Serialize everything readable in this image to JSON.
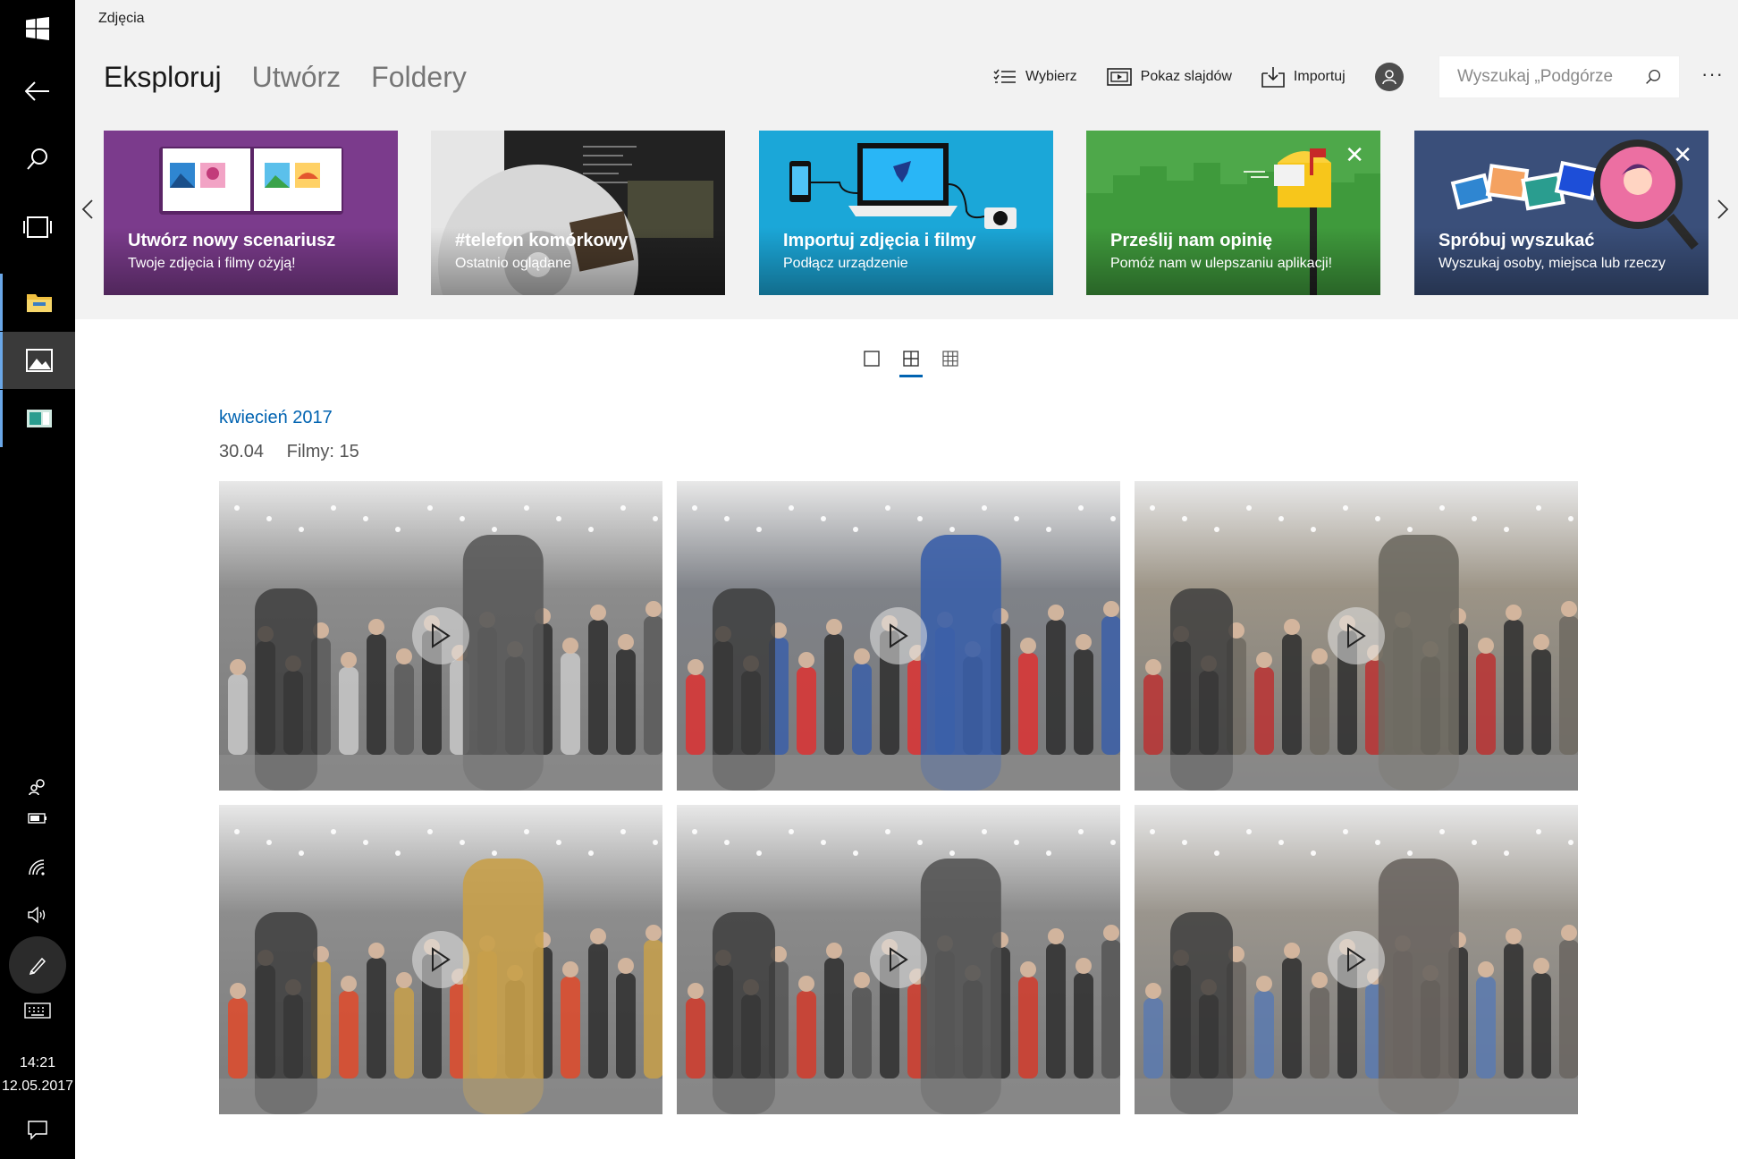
{
  "app": {
    "title": "Zdjęcia"
  },
  "tabs": [
    {
      "label": "Eksploruj",
      "active": true
    },
    {
      "label": "Utwórz",
      "active": false
    },
    {
      "label": "Foldery",
      "active": false
    }
  ],
  "toolbar": {
    "select_label": "Wybierz",
    "slideshow_label": "Pokaz slajdów",
    "import_label": "Importuj",
    "more_label": "···"
  },
  "search": {
    "placeholder": "Wyszukaj „Podgórze"
  },
  "cards": [
    {
      "title": "Utwórz nowy scenariusz",
      "subtitle": "Twoje zdjęcia i filmy ożyją!",
      "color": "#7b3b8c"
    },
    {
      "title": "#telefon komórkowy",
      "subtitle": "Ostatnio oglądane",
      "color": "#cfcfcf"
    },
    {
      "title": "Importuj zdjęcia i filmy",
      "subtitle": "Podłącz urządzenie",
      "color": "#1ba7d8"
    },
    {
      "title": "Prześlij nam opinię",
      "subtitle": "Pomóż nam w ulepszaniu aplikacji!",
      "color": "#4ea84a"
    },
    {
      "title": "Spróbuj wyszukać",
      "subtitle": "Wyszukaj osoby, miejsca lub rzeczy",
      "color": "#3a4f7a"
    }
  ],
  "timeline": {
    "month": "kwiecień 2017",
    "date": "30.04",
    "count": "Filmy: 15"
  },
  "videos": [
    {
      "name": "video-1",
      "palette": [
        "#8c8c8c",
        "#5a5a5a",
        "#c9c9c9"
      ]
    },
    {
      "name": "video-2",
      "palette": [
        "#7f8288",
        "#3b5fa8",
        "#d33"
      ]
    },
    {
      "name": "video-3",
      "palette": [
        "#9c9486",
        "#6e6a62",
        "#b33"
      ]
    },
    {
      "name": "video-4",
      "palette": [
        "#8d8d8d",
        "#c8a04a",
        "#e04a2a"
      ]
    },
    {
      "name": "video-5",
      "palette": [
        "#8a8a8a",
        "#555555",
        "#d23b2b"
      ]
    },
    {
      "name": "video-6",
      "palette": [
        "#9a958d",
        "#6a6560",
        "#5a7ab0"
      ]
    }
  ],
  "taskbar": {
    "time": "14:21",
    "date": "12.05.2017",
    "icons": [
      "windows-start-icon",
      "back-icon",
      "search-icon",
      "task-view-icon",
      "file-explorer-icon",
      "photos-app-icon",
      "media-app-icon",
      "people-icon",
      "battery-icon",
      "wifi-icon",
      "volume-icon",
      "pen-icon",
      "keyboard-icon",
      "action-center-icon"
    ]
  }
}
